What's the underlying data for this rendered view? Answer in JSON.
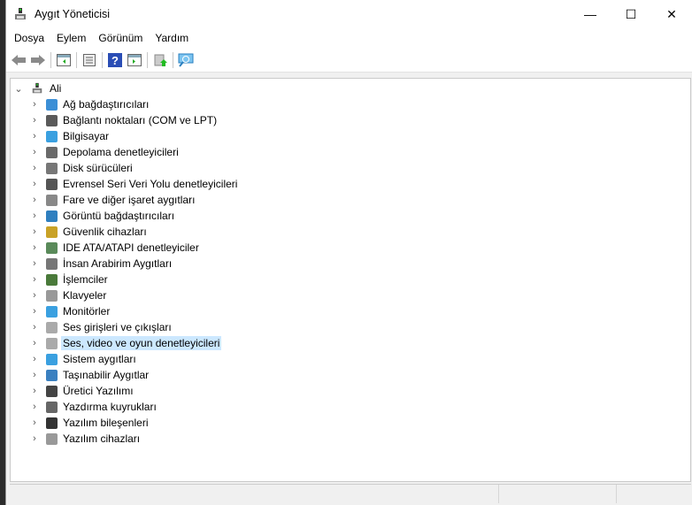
{
  "window": {
    "title": "Aygıt Yöneticisi",
    "minimize": "—",
    "maximize": "☐",
    "close": "✕"
  },
  "menu": [
    "Dosya",
    "Eylem",
    "Görünüm",
    "Yardım"
  ],
  "toolbar": [
    "back",
    "forward",
    "show-hide-console-tree",
    "properties",
    "help",
    "show-action-pane",
    "update-driver",
    "scan-hardware"
  ],
  "tree": {
    "root": "Ali",
    "items": [
      {
        "label": "Ağ bağdaştırıcıları",
        "icon": "network-adapter-icon",
        "color": "#3c8fd6"
      },
      {
        "label": "Bağlantı noktaları (COM ve LPT)",
        "icon": "port-icon",
        "color": "#5a5a5a"
      },
      {
        "label": "Bilgisayar",
        "icon": "computer-icon",
        "color": "#3aa0e0"
      },
      {
        "label": "Depolama denetleyicileri",
        "icon": "storage-controller-icon",
        "color": "#6a6a6a"
      },
      {
        "label": "Disk sürücüleri",
        "icon": "disk-drive-icon",
        "color": "#777"
      },
      {
        "label": "Evrensel Seri Veri Yolu denetleyicileri",
        "icon": "usb-icon",
        "color": "#555"
      },
      {
        "label": "Fare ve diğer işaret aygıtları",
        "icon": "mouse-icon",
        "color": "#888"
      },
      {
        "label": "Görüntü bağdaştırıcıları",
        "icon": "display-adapter-icon",
        "color": "#2f7fbf"
      },
      {
        "label": "Güvenlik cihazları",
        "icon": "security-device-icon",
        "color": "#c9a227"
      },
      {
        "label": "IDE ATA/ATAPI denetleyiciler",
        "icon": "ide-icon",
        "color": "#5a8a5a"
      },
      {
        "label": "İnsan Arabirim Aygıtları",
        "icon": "hid-icon",
        "color": "#777"
      },
      {
        "label": "İşlemciler",
        "icon": "processor-icon",
        "color": "#4a7a3a"
      },
      {
        "label": "Klavyeler",
        "icon": "keyboard-icon",
        "color": "#999"
      },
      {
        "label": "Monitörler",
        "icon": "monitor-icon",
        "color": "#3aa0e0"
      },
      {
        "label": "Ses girişleri ve çıkışları",
        "icon": "speaker-icon",
        "color": "#aaa"
      },
      {
        "label": "Ses, video ve oyun denetleyicileri",
        "icon": "sound-icon",
        "color": "#aaa",
        "selected": true
      },
      {
        "label": "Sistem aygıtları",
        "icon": "system-device-icon",
        "color": "#3aa0e0"
      },
      {
        "label": "Taşınabilir Aygıtlar",
        "icon": "portable-device-icon",
        "color": "#3a80c0"
      },
      {
        "label": "Üretici Yazılımı",
        "icon": "firmware-icon",
        "color": "#444"
      },
      {
        "label": "Yazdırma kuyrukları",
        "icon": "printer-icon",
        "color": "#666"
      },
      {
        "label": "Yazılım bileşenleri",
        "icon": "software-component-icon",
        "color": "#333"
      },
      {
        "label": "Yazılım cihazları",
        "icon": "software-device-icon",
        "color": "#999"
      }
    ]
  }
}
